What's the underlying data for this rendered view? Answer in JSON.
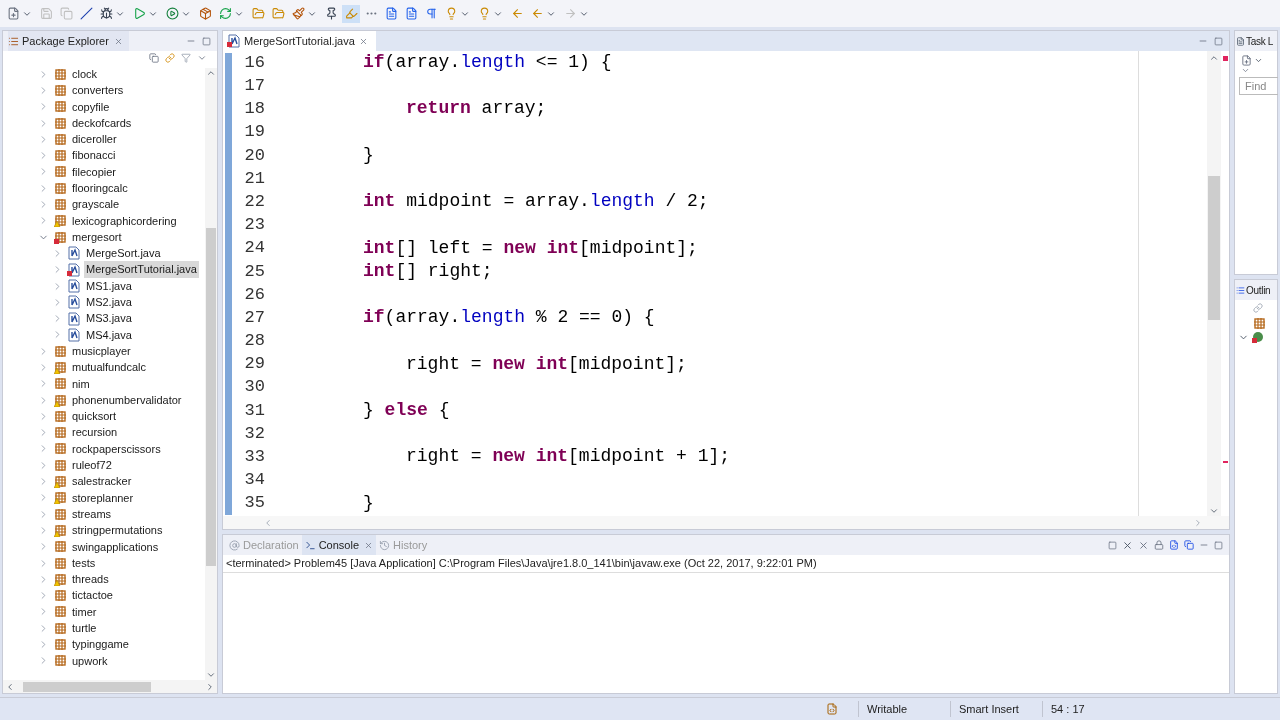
{
  "toolbar": {
    "buttons": [
      {
        "kind": "new",
        "menu": true
      },
      {
        "kind": "save",
        "menu": false
      },
      {
        "kind": "save_all",
        "menu": false
      },
      {
        "kind": "skip",
        "menu": false
      },
      {
        "kind": "debug",
        "menu": true
      },
      {
        "kind": "run",
        "menu": true
      },
      {
        "kind": "run_ext",
        "menu": true
      },
      {
        "kind": "package",
        "menu": false
      },
      {
        "kind": "refresh",
        "menu": true
      },
      {
        "kind": "folder",
        "menu": false
      },
      {
        "kind": "folder",
        "menu": false
      },
      {
        "kind": "brush",
        "menu": true
      },
      {
        "kind": "pin",
        "menu": false
      },
      {
        "kind": "highlight",
        "menu": false
      },
      {
        "kind": "dots",
        "menu": false
      },
      {
        "kind": "doc",
        "menu": false
      },
      {
        "kind": "doc",
        "menu": false
      },
      {
        "kind": "pilcrow",
        "menu": false
      },
      {
        "kind": "annot",
        "menu": true
      },
      {
        "kind": "annot",
        "menu": true
      },
      {
        "kind": "back",
        "menu": false
      },
      {
        "kind": "back",
        "menu": true
      },
      {
        "kind": "forward",
        "menu": true
      }
    ]
  },
  "package_explorer": {
    "title": "Package Explorer",
    "items": [
      {
        "name": "clock",
        "kind": "package",
        "warning": false,
        "error": false,
        "expanded": false
      },
      {
        "name": "converters",
        "kind": "package",
        "warning": false,
        "error": false,
        "expanded": false
      },
      {
        "name": "copyfile",
        "kind": "package",
        "warning": false,
        "error": false,
        "expanded": false
      },
      {
        "name": "deckofcards",
        "kind": "package",
        "warning": false,
        "error": false,
        "expanded": false
      },
      {
        "name": "diceroller",
        "kind": "package",
        "warning": false,
        "error": false,
        "expanded": false
      },
      {
        "name": "fibonacci",
        "kind": "package",
        "warning": false,
        "error": false,
        "expanded": false
      },
      {
        "name": "filecopier",
        "kind": "package",
        "warning": false,
        "error": false,
        "expanded": false
      },
      {
        "name": "flooringcalc",
        "kind": "package",
        "warning": false,
        "error": false,
        "expanded": false
      },
      {
        "name": "grayscale",
        "kind": "package",
        "warning": false,
        "error": false,
        "expanded": false
      },
      {
        "name": "lexicographicordering",
        "kind": "package",
        "warning": true,
        "error": false,
        "expanded": false
      },
      {
        "name": "mergesort",
        "kind": "package",
        "warning": false,
        "error": true,
        "expanded": true,
        "children": [
          {
            "name": "MergeSort.java",
            "kind": "java",
            "error": false,
            "selected": false
          },
          {
            "name": "MergeSortTutorial.java",
            "kind": "java",
            "error": true,
            "selected": true
          },
          {
            "name": "MS1.java",
            "kind": "java",
            "error": false,
            "selected": false
          },
          {
            "name": "MS2.java",
            "kind": "java",
            "error": false,
            "selected": false
          },
          {
            "name": "MS3.java",
            "kind": "java",
            "error": false,
            "selected": false
          },
          {
            "name": "MS4.java",
            "kind": "java",
            "error": false,
            "selected": false
          }
        ]
      },
      {
        "name": "musicplayer",
        "kind": "package",
        "warning": false,
        "error": false,
        "expanded": false
      },
      {
        "name": "mutualfundcalc",
        "kind": "package",
        "warning": true,
        "error": false,
        "expanded": false
      },
      {
        "name": "nim",
        "kind": "package",
        "warning": false,
        "error": false,
        "expanded": false
      },
      {
        "name": "phonenumbervalidator",
        "kind": "package",
        "warning": true,
        "error": false,
        "expanded": false
      },
      {
        "name": "quicksort",
        "kind": "package",
        "warning": false,
        "error": false,
        "expanded": false
      },
      {
        "name": "recursion",
        "kind": "package",
        "warning": false,
        "error": false,
        "expanded": false
      },
      {
        "name": "rockpaperscissors",
        "kind": "package",
        "warning": false,
        "error": false,
        "expanded": false
      },
      {
        "name": "ruleof72",
        "kind": "package",
        "warning": false,
        "error": false,
        "expanded": false
      },
      {
        "name": "salestracker",
        "kind": "package",
        "warning": true,
        "error": false,
        "expanded": false
      },
      {
        "name": "storeplanner",
        "kind": "package",
        "warning": true,
        "error": false,
        "expanded": false
      },
      {
        "name": "streams",
        "kind": "package",
        "warning": false,
        "error": false,
        "expanded": false
      },
      {
        "name": "stringpermutations",
        "kind": "package",
        "warning": true,
        "error": false,
        "expanded": false
      },
      {
        "name": "swingapplications",
        "kind": "package",
        "warning": false,
        "error": false,
        "expanded": false
      },
      {
        "name": "tests",
        "kind": "package",
        "warning": false,
        "error": false,
        "expanded": false
      },
      {
        "name": "threads",
        "kind": "package",
        "warning": true,
        "error": false,
        "expanded": false
      },
      {
        "name": "tictactoe",
        "kind": "package",
        "warning": false,
        "error": false,
        "expanded": false
      },
      {
        "name": "timer",
        "kind": "package",
        "warning": false,
        "error": false,
        "expanded": false
      },
      {
        "name": "turtle",
        "kind": "package",
        "warning": false,
        "error": false,
        "expanded": false
      },
      {
        "name": "typinggame",
        "kind": "package",
        "warning": false,
        "error": false,
        "expanded": false
      },
      {
        "name": "upwork",
        "kind": "package",
        "warning": false,
        "error": false,
        "expanded": false
      }
    ]
  },
  "editor": {
    "tab": {
      "title": "MergeSortTutorial.java",
      "error": true
    },
    "lines": [
      {
        "number": "16",
        "nested": false,
        "tokens": [
          {
            "kind": "keyword",
            "text": "if"
          },
          {
            "kind": "plain",
            "text": "(array."
          },
          {
            "kind": "field",
            "text": "length"
          },
          {
            "kind": "plain",
            "text": " <= 1) {"
          }
        ]
      },
      {
        "number": "17"
      },
      {
        "number": "18",
        "nested": true,
        "tokens": [
          {
            "kind": "keyword",
            "text": "return"
          },
          {
            "kind": "plain",
            "text": " array;"
          }
        ]
      },
      {
        "number": "19"
      },
      {
        "number": "20",
        "nested": false,
        "tokens": [
          {
            "kind": "plain",
            "text": "}"
          }
        ]
      },
      {
        "number": "21"
      },
      {
        "number": "22",
        "nested": false,
        "tokens": [
          {
            "kind": "keyword",
            "text": "int"
          },
          {
            "kind": "plain",
            "text": " midpoint = array."
          },
          {
            "kind": "field",
            "text": "length"
          },
          {
            "kind": "plain",
            "text": " / 2;"
          }
        ]
      },
      {
        "number": "23"
      },
      {
        "number": "24",
        "nested": false,
        "tokens": [
          {
            "kind": "keyword",
            "text": "int"
          },
          {
            "kind": "plain",
            "text": "[] left = "
          },
          {
            "kind": "keyword",
            "text": "new int"
          },
          {
            "kind": "plain",
            "text": "[midpoint];"
          }
        ]
      },
      {
        "number": "25",
        "nested": false,
        "tokens": [
          {
            "kind": "keyword",
            "text": "int"
          },
          {
            "kind": "plain",
            "text": "[] right;"
          }
        ]
      },
      {
        "number": "26"
      },
      {
        "number": "27",
        "nested": false,
        "tokens": [
          {
            "kind": "keyword",
            "text": "if"
          },
          {
            "kind": "plain",
            "text": "(array."
          },
          {
            "kind": "field",
            "text": "length"
          },
          {
            "kind": "plain",
            "text": " % 2 == 0) {"
          }
        ]
      },
      {
        "number": "28"
      },
      {
        "number": "29",
        "nested": true,
        "tokens": [
          {
            "kind": "plain",
            "text": "right = "
          },
          {
            "kind": "keyword",
            "text": "new int"
          },
          {
            "kind": "plain",
            "text": "[midpoint];"
          }
        ]
      },
      {
        "number": "30"
      },
      {
        "number": "31",
        "nested": false,
        "tokens": [
          {
            "kind": "plain",
            "text": "} "
          },
          {
            "kind": "keyword",
            "text": "else"
          },
          {
            "kind": "plain",
            "text": " {"
          }
        ]
      },
      {
        "number": "32"
      },
      {
        "number": "33",
        "nested": true,
        "tokens": [
          {
            "kind": "plain",
            "text": "right = "
          },
          {
            "kind": "keyword",
            "text": "new int"
          },
          {
            "kind": "plain",
            "text": "[midpoint + 1];"
          }
        ]
      },
      {
        "number": "34"
      },
      {
        "number": "35",
        "nested": false,
        "tokens": [
          {
            "kind": "plain",
            "text": "}"
          }
        ]
      }
    ]
  },
  "task_list": {
    "title": "Task L",
    "find": {
      "placeholder": "Find"
    }
  },
  "outline": {
    "title": "Outlin"
  },
  "bottom_panel": {
    "tabs": [
      {
        "label": "Declaration",
        "selected": false
      },
      {
        "label": "Console",
        "selected": true
      },
      {
        "label": "History",
        "selected": false
      }
    ],
    "console_header": "<terminated> Problem45 [Java Application] C:\\Program Files\\Java\\jre1.8.0_141\\bin\\javaw.exe (Oct 22, 2017, 9:22:01 PM)"
  },
  "status_bar": {
    "fields": [
      "Writable",
      "Smart Insert",
      "54 : 17"
    ]
  }
}
